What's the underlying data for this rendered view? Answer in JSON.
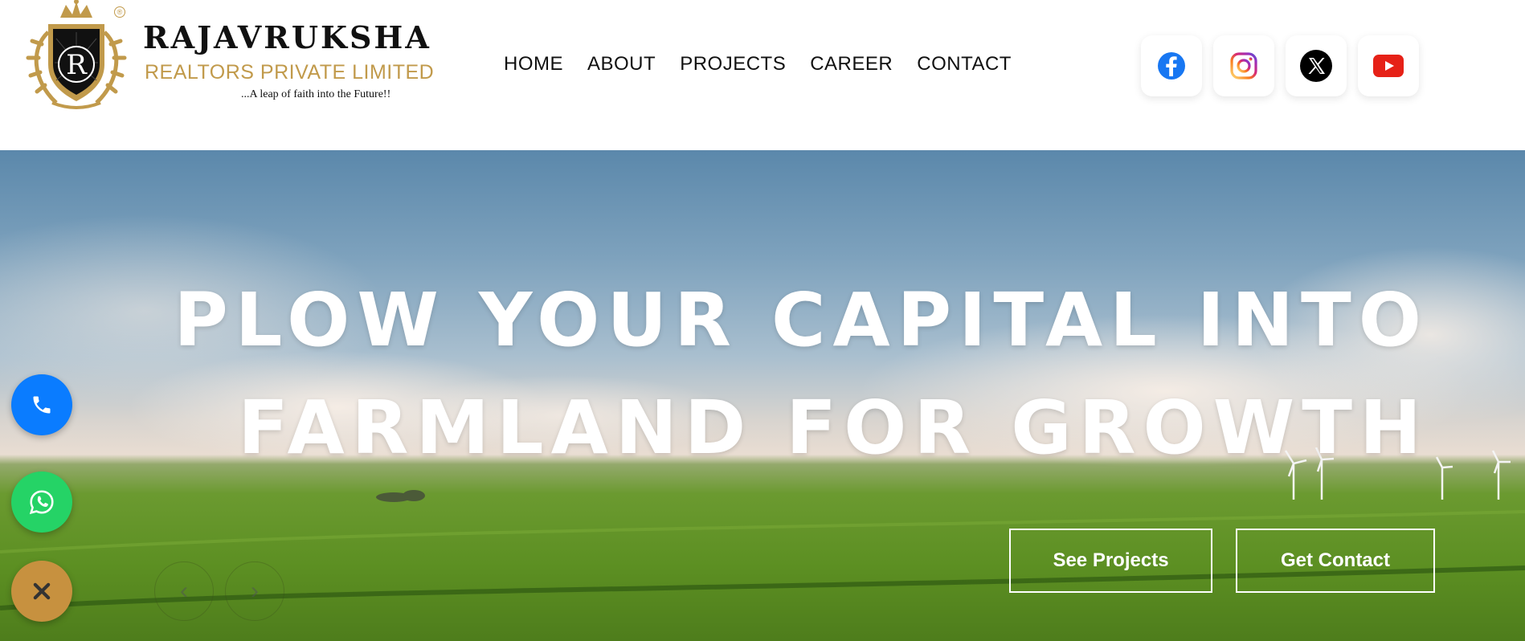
{
  "brand": {
    "emblem_letter": "R",
    "name": "RAJAVRUKSHA",
    "subtitle": "REALTORS PRIVATE LIMITED",
    "tagline": "...A leap of faith into the Future!!"
  },
  "nav": {
    "items": [
      {
        "label": "HOME"
      },
      {
        "label": "ABOUT"
      },
      {
        "label": "PROJECTS"
      },
      {
        "label": "CAREER"
      },
      {
        "label": "CONTACT"
      }
    ]
  },
  "social": {
    "icons": [
      "facebook-icon",
      "instagram-icon",
      "x-icon",
      "youtube-icon"
    ]
  },
  "hero": {
    "title_line1": "PLOW YOUR CAPITAL INTO",
    "title_line2": "FARMLAND FOR GROWTH",
    "buttons": {
      "projects": "See Projects",
      "contact": "Get Contact"
    },
    "arrows": {
      "prev": "‹",
      "next": "›"
    }
  },
  "floating": {
    "icons": [
      "phone-icon",
      "whatsapp-icon",
      "close-icon"
    ],
    "colors": {
      "phone": "#0a7cff",
      "whatsapp": "#25d366",
      "close": "#c7913f"
    }
  },
  "colors": {
    "gold": "#c19a4b",
    "text": "#111111"
  }
}
